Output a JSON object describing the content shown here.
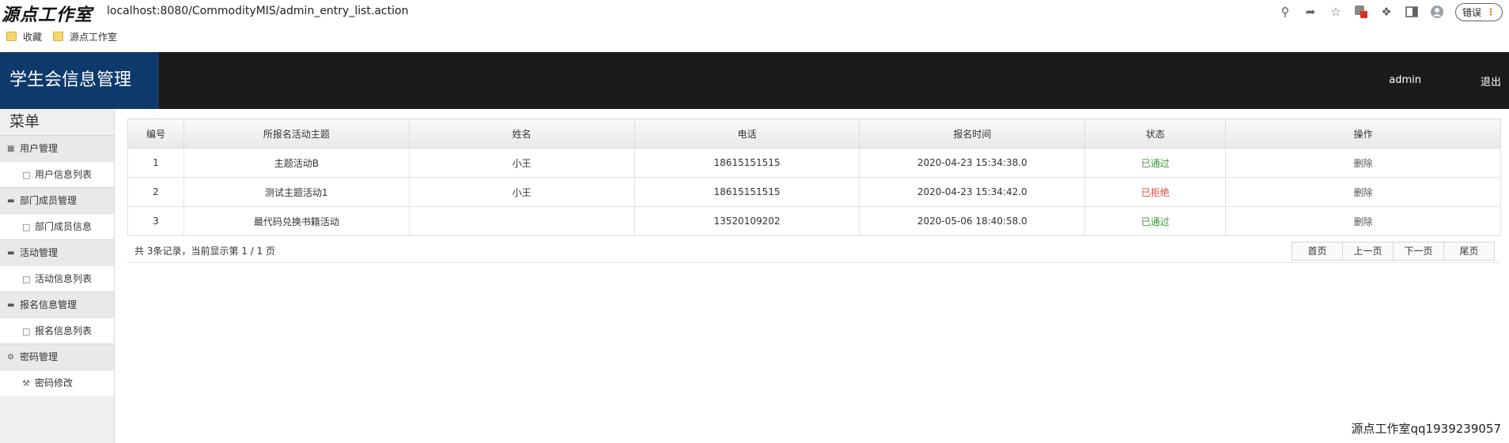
{
  "browser": {
    "watermark": "源点工作室",
    "url": "localhost:8080/CommodityMIS/admin_entry_list.action",
    "error_label": "错误",
    "bookmarks": [
      "收藏",
      "源点工作室"
    ]
  },
  "header": {
    "brand": "学生会信息管理",
    "user": "admin",
    "logout": "退出"
  },
  "sidebar": {
    "title": "菜单",
    "groups": [
      {
        "label": "用户管理",
        "items": [
          "用户信息列表"
        ]
      },
      {
        "label": "部门成员管理",
        "items": [
          "部门成员信息"
        ]
      },
      {
        "label": "活动管理",
        "items": [
          "活动信息列表"
        ]
      },
      {
        "label": "报名信息管理",
        "items": [
          "报名信息列表"
        ]
      },
      {
        "label": "密码管理",
        "items": [
          "密码修改"
        ]
      }
    ]
  },
  "table": {
    "headers": [
      "编号",
      "所报名活动主题",
      "姓名",
      "电话",
      "报名时间",
      "状态",
      "操作"
    ],
    "rows": [
      [
        "1",
        "主题活动B",
        "小王",
        "18615151515",
        "2020-04-23 15:34:38.0",
        "已通过",
        "删除"
      ],
      [
        "2",
        "测试主题活动1",
        "小王",
        "18615151515",
        "2020-04-23 15:34:42.0",
        "已拒绝",
        "删除"
      ],
      [
        "3",
        "最代码兑换书籍活动",
        "",
        "13520109202",
        "2020-05-06 18:40:58.0",
        "已通过",
        "删除"
      ]
    ]
  },
  "pager": {
    "info": "共 3条记录，当前显示第  1 / 1 页",
    "first": "首页",
    "prev": "上一页",
    "next": "下一页",
    "last": "尾页"
  },
  "footer_watermark": "源点工作室qq1939239057",
  "colors": {
    "pass": "#3a9a2e",
    "reject": "#e0453b",
    "brand_bg": "#0e3a6b",
    "header_bg": "#1b1b1b"
  }
}
